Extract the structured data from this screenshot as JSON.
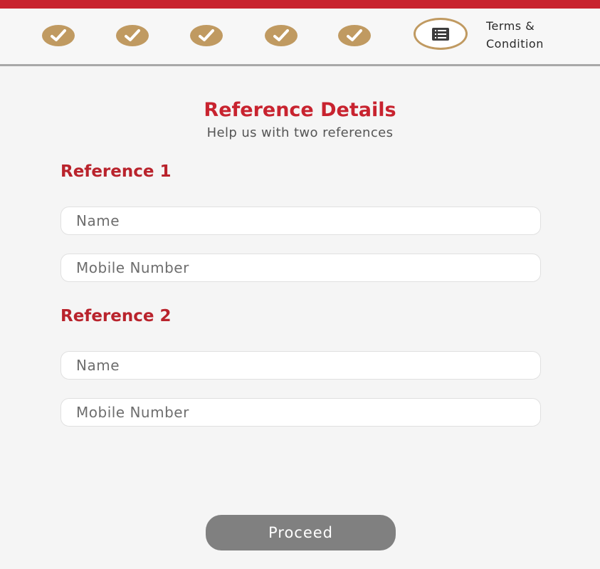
{
  "colors": {
    "brand_red": "#c8232f",
    "step_gold": "#c09a61",
    "button_gray": "#808080"
  },
  "stepper": {
    "completed_steps": [
      {
        "icon": "check-icon",
        "status": "completed"
      },
      {
        "icon": "check-icon",
        "status": "completed"
      },
      {
        "icon": "check-icon",
        "status": "completed"
      },
      {
        "icon": "check-icon",
        "status": "completed"
      },
      {
        "icon": "check-icon",
        "status": "completed"
      }
    ],
    "current_step": {
      "icon": "list-icon",
      "label_line1": "Terms &",
      "label_line2": "Condition"
    }
  },
  "page": {
    "title": "Reference Details",
    "subtitle": "Help us with two references"
  },
  "reference1": {
    "heading": "Reference 1",
    "name_placeholder": "Name",
    "name_value": "",
    "mobile_placeholder": "Mobile Number",
    "mobile_value": ""
  },
  "reference2": {
    "heading": "Reference 2",
    "name_placeholder": "Name",
    "name_value": "",
    "mobile_placeholder": "Mobile Number",
    "mobile_value": ""
  },
  "actions": {
    "proceed_label": "Proceed"
  }
}
